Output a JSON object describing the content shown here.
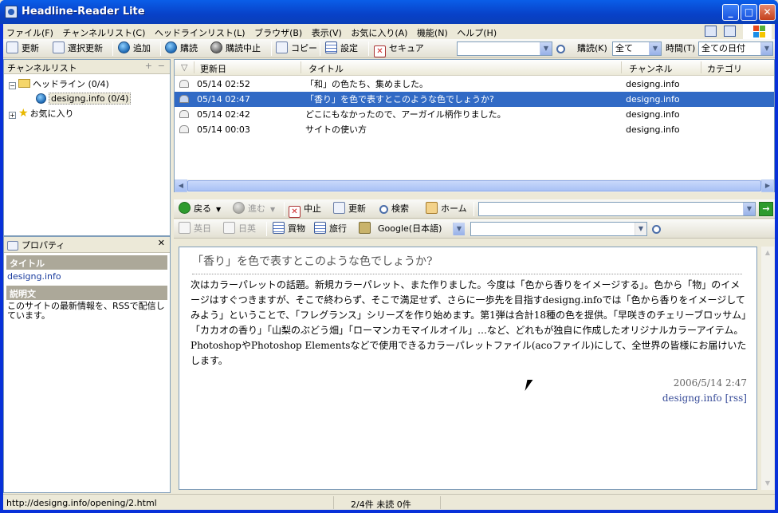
{
  "window": {
    "title": "Headline-Reader Lite"
  },
  "menu": [
    "ファイル(F)",
    "チャンネルリスト(C)",
    "ヘッドラインリスト(L)",
    "ブラウザ(B)",
    "表示(V)",
    "お気に入り(A)",
    "機能(N)",
    "ヘルプ(H)"
  ],
  "toolbar": {
    "update": "更新",
    "update_selected": "選択更新",
    "add": "追加",
    "subscribe": "購読",
    "unsubscribe": "購読中止",
    "copy": "コピー",
    "settings": "設定",
    "secure": "セキュア",
    "filter_label": "購読(K)",
    "filter_value": "全て",
    "time_label": "時間(T)",
    "time_value": "全ての日付"
  },
  "channel_panel": {
    "title": "チャンネルリスト",
    "tree": {
      "headlines": "ヘッドライン (0/4)",
      "site": "designg.info (0/4)",
      "favorites": "お気に入り"
    }
  },
  "headlines": {
    "columns": {
      "date": "更新日",
      "title": "タイトル",
      "channel": "チャンネル",
      "category": "カテゴリ"
    },
    "rows": [
      {
        "date": "05/14 02:52",
        "title": "「和」の色たち、集めました。",
        "channel": "designg.info"
      },
      {
        "date": "05/14 02:47",
        "title": "「香り」を色で表すとこのような色でしょうか?",
        "channel": "designg.info"
      },
      {
        "date": "05/14 02:42",
        "title": "どこにもなかったので、アーガイル柄作りました。",
        "channel": "designg.info"
      },
      {
        "date": "05/14 00:03",
        "title": "サイトの使い方",
        "channel": "designg.info"
      }
    ]
  },
  "browser": {
    "back": "戻る",
    "forward": "進む",
    "stop": "中止",
    "refresh": "更新",
    "search": "検索",
    "home": "ホーム",
    "eiji": "英日",
    "nichiei": "日英",
    "shopping": "買物",
    "travel": "旅行",
    "search_engine": "Google(日本語)"
  },
  "properties": {
    "title": "プロパティ",
    "title_label": "タイトル",
    "title_value": "designg.info",
    "desc_label": "説明文",
    "desc_value": "このサイトの最新情報を、RSSで配信しています。"
  },
  "article": {
    "title": "「香り」を色で表すとこのような色でしょうか?",
    "body": "次はカラーパレットの話題。新規カラーパレット、また作りました。今度は「色から香りをイメージする」。色から「物」のイメージはすぐつきますが、そこで終わらず、そこで満足せず、さらに一歩先を目指すdesigng.infoでは「色から香りをイメージしてみよう」ということで、「フレグランス」シリーズを作り始めます。第1弾は合計18種の色を提供。「早咲きのチェリーブロッサム」「カカオの香り」「山梨のぶどう畑」「ローマンカモマイルオイル」…など、どれもが独自に作成したオリジナルカラーアイテム。PhotoshopやPhotoshop Elementsなどで使用できるカラーパレットファイル(acoファイル)にして、全世界の皆様にお届けいたします。",
    "date": "2006/5/14 2:47",
    "source": "designg.info [rss]"
  },
  "status": {
    "url": "http://designg.info/opening/2.html",
    "count": "2/4件 未読 0件"
  },
  "colors": {
    "selection": "#316ac5",
    "titlebar": "#0a5ee8"
  }
}
